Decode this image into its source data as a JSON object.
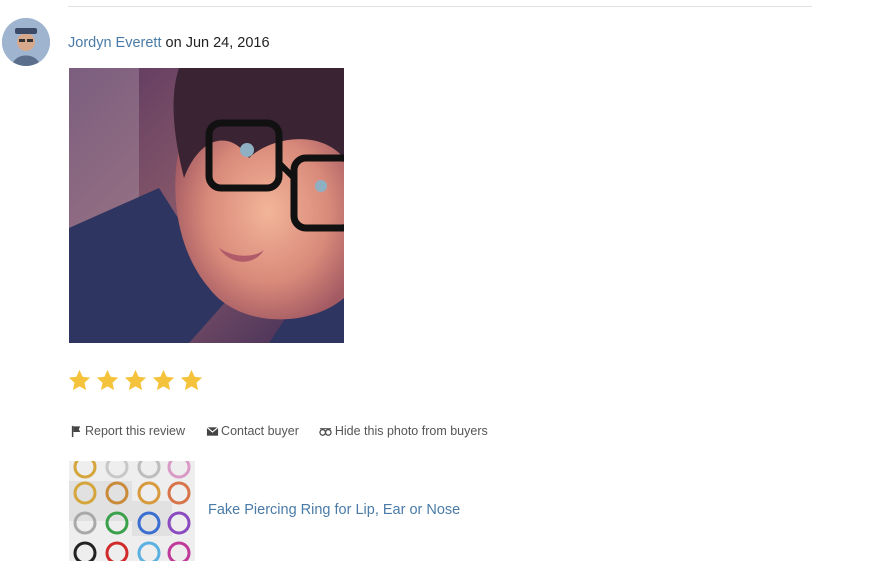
{
  "review": {
    "reviewer_name": "Jordyn Everett",
    "date_prefix": " on ",
    "date": "Jun 24, 2016",
    "rating": 5,
    "rating_max": 5,
    "actions": {
      "report": "Report this review",
      "contact": "Contact buyer",
      "hide_photo": "Hide this photo from buyers"
    }
  },
  "product": {
    "title": "Fake Piercing Ring for Lip, Ear or Nose"
  },
  "colors": {
    "link": "#4a7ba7",
    "star": "#f5c33b",
    "muted_text": "#555555"
  },
  "icons": {
    "report": "flag-icon",
    "contact": "envelope-icon",
    "hide_photo": "eye-hidden-icon",
    "star": "star-icon"
  }
}
